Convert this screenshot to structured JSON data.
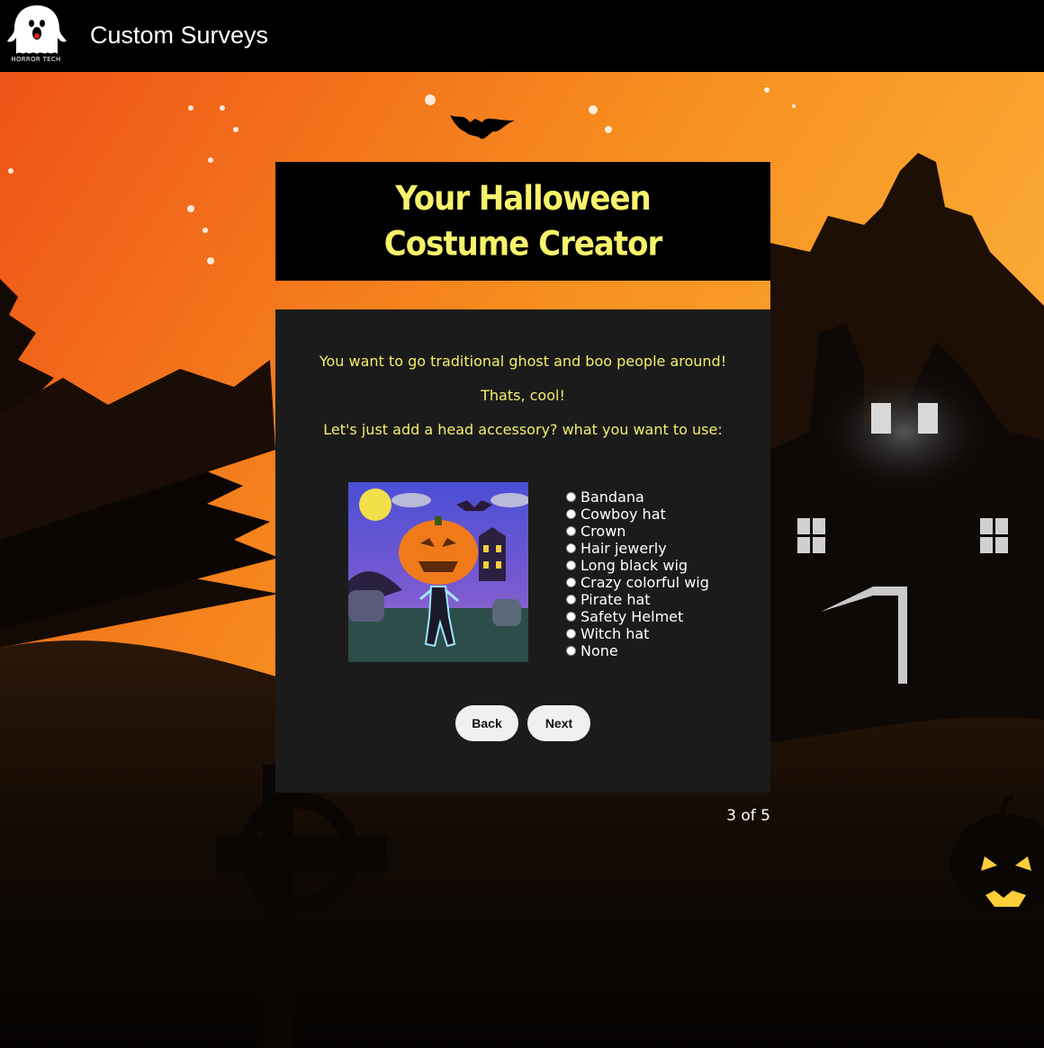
{
  "header": {
    "brand": "HORROR TECH",
    "title": "Custom Surveys"
  },
  "survey": {
    "title": "Your Halloween Costume Creator",
    "messages": [
      "You want to go traditional ghost and boo people around!",
      "Thats, cool!",
      "Let's just add a head accessory? what you want to use:"
    ],
    "options": [
      "Bandana",
      "Cowboy hat",
      "Crown",
      "Hair jewerly",
      "Long black wig",
      "Crazy colorful wig",
      "Pirate hat",
      "Safety Helmet",
      "Witch hat",
      "None"
    ],
    "back_label": "Back",
    "next_label": "Next",
    "progress": "3 of 5"
  },
  "colors": {
    "accent_yellow": "#f7f36b",
    "panel": "#1b1b1b",
    "sky_top": "#f15a1c",
    "sky_bottom": "#fbb03b"
  },
  "icons": [
    "ghost-logo-icon",
    "bat-icon",
    "radio-icon"
  ]
}
